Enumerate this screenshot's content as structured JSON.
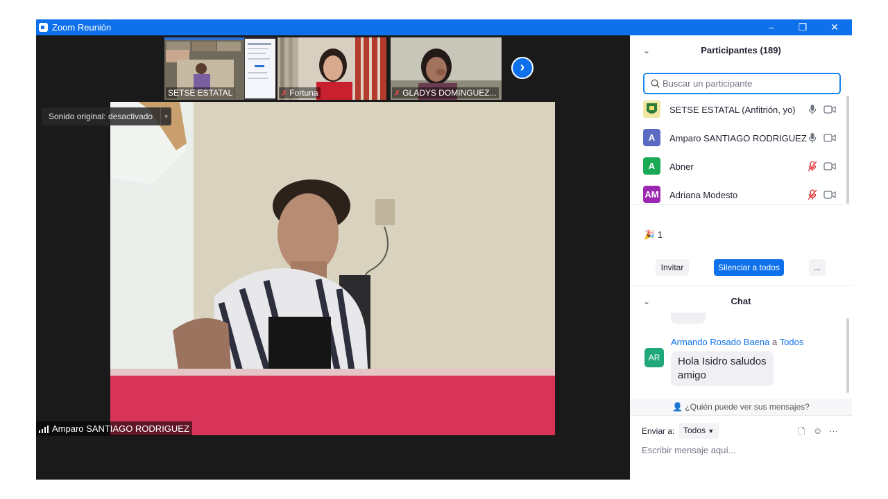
{
  "window": {
    "title": "Zoom Reunión",
    "controls": [
      "–",
      "❐",
      "✕"
    ]
  },
  "thumbnails": [
    {
      "name": "SETSE ESTATAL",
      "muted": false
    },
    {
      "name": "Fortuna",
      "muted": true
    },
    {
      "name": "GLADYS DOMINGUEZ...",
      "muted": true
    }
  ],
  "next_label": "›",
  "sound_pill": {
    "label": "Sonido original: desactivado",
    "caret": "▾"
  },
  "active_speaker": "Amparo SANTIAGO RODRIGUEZ",
  "participants_panel": {
    "title": "Participantes (189)",
    "search_placeholder": "Buscar un participante",
    "items": [
      {
        "avatar": "",
        "avatar_color": "#e8d96a",
        "name": "SETSE ESTATAL (Anfitrión, yo)",
        "mic": "on"
      },
      {
        "avatar": "A",
        "avatar_color": "#5b6bc4",
        "name": "Amparo SANTIAGO RODRIGUEZ",
        "mic": "on"
      },
      {
        "avatar": "A",
        "avatar_color": "#1aaa55",
        "name": "Abner",
        "mic": "muted"
      },
      {
        "avatar": "AM",
        "avatar_color": "#9c27b0",
        "name": "Adriana Modesto",
        "mic": "muted"
      }
    ],
    "reaction_count": "1",
    "invite_label": "Invitar",
    "mute_all_label": "Silenciar a todos",
    "more_label": "..."
  },
  "chat": {
    "title": "Chat",
    "message": {
      "sender": "Armando Rosado Baena",
      "to_word": "a",
      "recipient": "Todos",
      "avatar": "AR",
      "text": "Hola Isidro saludos amigo"
    },
    "who_can_see": "¿Quién puede ver sus mensajes?",
    "send_to_label": "Enviar a:",
    "send_to_value": "Todos",
    "compose_placeholder": "Escribir mensaje aquí...",
    "more_label": "···"
  },
  "colors": {
    "accent": "#0e71eb",
    "muted_red": "#e02828"
  }
}
